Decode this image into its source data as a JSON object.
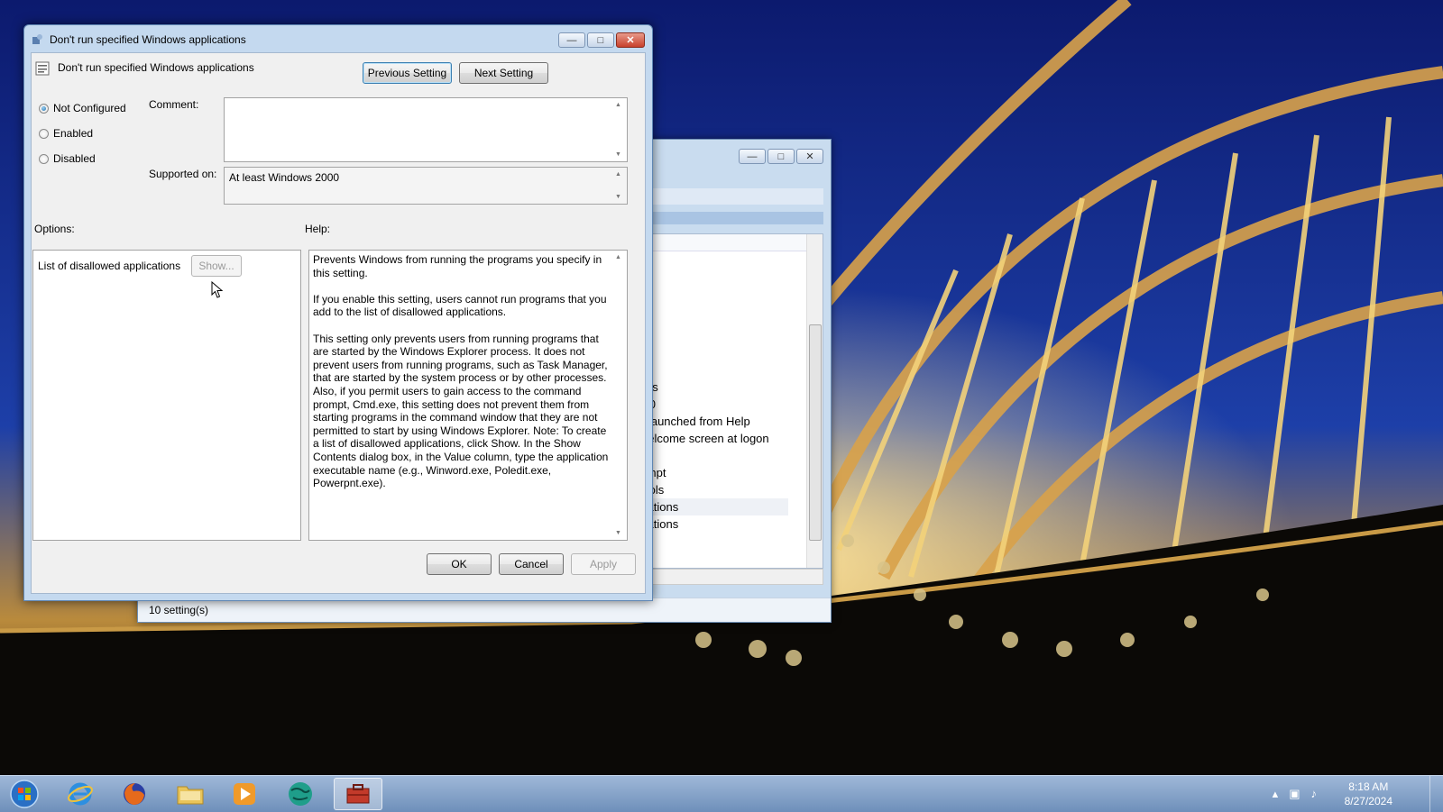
{
  "dialog": {
    "title": "Don't run specified Windows applications",
    "setting_name": "Don't run specified Windows applications",
    "prev_button": "Previous Setting",
    "next_button": "Next Setting",
    "radio_not_configured": "Not Configured",
    "radio_enabled": "Enabled",
    "radio_disabled": "Disabled",
    "selected_state": "Not Configured",
    "comment_label": "Comment:",
    "comment_value": "",
    "supported_label": "Supported on:",
    "supported_value": "At least Windows 2000",
    "options_label": "Options:",
    "help_label": "Help:",
    "option_list_label": "List of disallowed applications",
    "show_button": "Show...",
    "help_paragraphs": [
      "Prevents Windows from running the programs you specify in this setting.",
      "If you enable this setting, users cannot run programs that you add to the list of disallowed applications.",
      "This setting only prevents users from running programs that are started by the Windows Explorer process. It does not prevent users from running programs, such as Task Manager, that are started by the system process or by other processes. Also, if you permit users to gain access to the command prompt, Cmd.exe, this setting does not prevent them from starting programs in the command window that they are not permitted to start by using Windows Explorer. Note: To create a list of disallowed applications, click Show. In the Show Contents dialog box, in the Value column, type the application executable name (e.g., Winword.exe, Poledit.exe, Powerpnt.exe)."
    ],
    "ok_button": "OK",
    "cancel_button": "Cancel",
    "apply_button": "Apply"
  },
  "background_window": {
    "list_items": [
      "nents",
      "2000",
      "ing launched from Help",
      "d welcome screen at logon",
      "",
      "prompt",
      "g tools",
      "plications",
      "plications"
    ],
    "selected_index": 7,
    "status_text": "10 setting(s)"
  },
  "taskbar": {
    "time": "8:18 AM",
    "date": "8/27/2024",
    "apps": [
      "start-orb",
      "internet-explorer",
      "firefox",
      "file-explorer",
      "media-player",
      "browser-globe",
      "group-policy-editor"
    ],
    "active_app": "group-policy-editor"
  },
  "colors": {
    "titlebar": "#c4d9ef",
    "dialog_face": "#f0f0f0",
    "taskbar": "#7f9cc4",
    "focus_border": "#3c7fb1"
  }
}
